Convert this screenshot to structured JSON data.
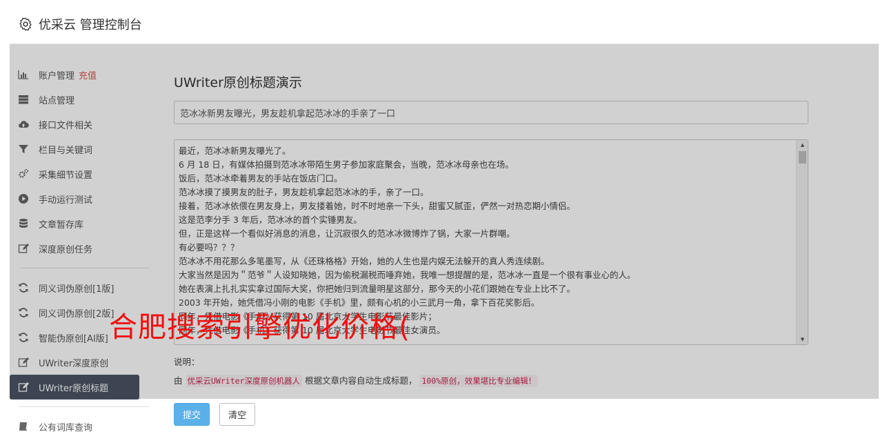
{
  "header": {
    "title": "优采云 管理控制台",
    "icon": "gear-icon"
  },
  "sidebar": {
    "items": [
      {
        "label": "账户管理",
        "badge": "充值",
        "icon": "bar-chart-icon"
      },
      {
        "label": "站点管理",
        "icon": "server-icon"
      },
      {
        "label": "接口文件相关",
        "icon": "cloud-upload-icon"
      },
      {
        "label": "栏目与关键词",
        "icon": "filter-icon"
      },
      {
        "label": "采集细节设置",
        "icon": "gears-icon"
      },
      {
        "label": "手动运行测试",
        "icon": "play-circle-icon"
      },
      {
        "label": "文章暂存库",
        "icon": "database-icon"
      },
      {
        "label": "深度原创任务",
        "icon": "edit-icon"
      },
      {
        "label": "同义词伪原创[1版]",
        "icon": "refresh-icon"
      },
      {
        "label": "同义词伪原创[2版]",
        "icon": "refresh-icon"
      },
      {
        "label": "智能伪原创[AI版]",
        "icon": "refresh-icon"
      },
      {
        "label": "UWriter深度原创",
        "icon": "edit-icon"
      },
      {
        "label": "UWriter原创标题",
        "icon": "edit-icon",
        "active": true
      },
      {
        "label": "公有词库查询",
        "icon": "book-icon"
      }
    ]
  },
  "main": {
    "page_title": "UWriter原创标题演示",
    "title_value": "范冰冰新男友曝光，男友趁机拿起范冰冰的手亲了一口",
    "content_lines": [
      "最近，范冰冰新男友曝光了。",
      "6 月 18 日，有媒体拍摄到范冰冰带陌生男子参加家庭聚会，当晚，范冰冰母亲也在场。",
      "饭后，范冰冰牵着男友的手站在饭店门口。",
      "范冰冰摸了摸男友的肚子，男友趁机拿起范冰冰的手，亲了一口。",
      "接着，范冰冰依偎在男友身上，男友搂着她，时不时地亲一下头，甜蜜又腻歪，俨然一对热恋期小情侣。",
      "这是范李分手 3 年后，范冰冰的首个实锤男友。",
      "但，正是这样一个看似好消息的消息，让沉寂很久的范冰冰微博炸了锅，大家一片群嘲。",
      "有必要吗？？？",
      "范冰冰不用花那么多笔墨写，从《还珠格格》开始，她的人生也是内娱无法躲开的真人秀连续剧。",
      "大家当然是因为＂范爷＂人设知晓她，因为偷税漏税而唾弃她，我唯一想提醒的是，范冰冰一直是一个很有事业心的人。",
      "她在表演上扎扎实实拿过国际大奖，你把她归到流量明星这部分，那今天的小花们跟她在专业上比不了。",
      "2003 年开始，她凭借冯小刚的电影《手机》里，颇有心机的小三武月一角，拿下百花奖影后。",
      "同年，凭借电影《手机》获得第 10 届北京大学生电影节最佳影片；",
      "同年，凭借电影《手机》获得第 10 届北京大学生电影节最佳女演员。"
    ],
    "note_label": "说明：",
    "note_prefix": "由",
    "note_code1": "优采云UWriter深度原创机器人",
    "note_middle": "根据文章内容自动生成标题，",
    "note_code2": "100%原创，效果堪比专业编辑！",
    "submit_label": "提交",
    "clear_label": "清空"
  },
  "watermark": "合肥搜索引擎优化价格("
}
